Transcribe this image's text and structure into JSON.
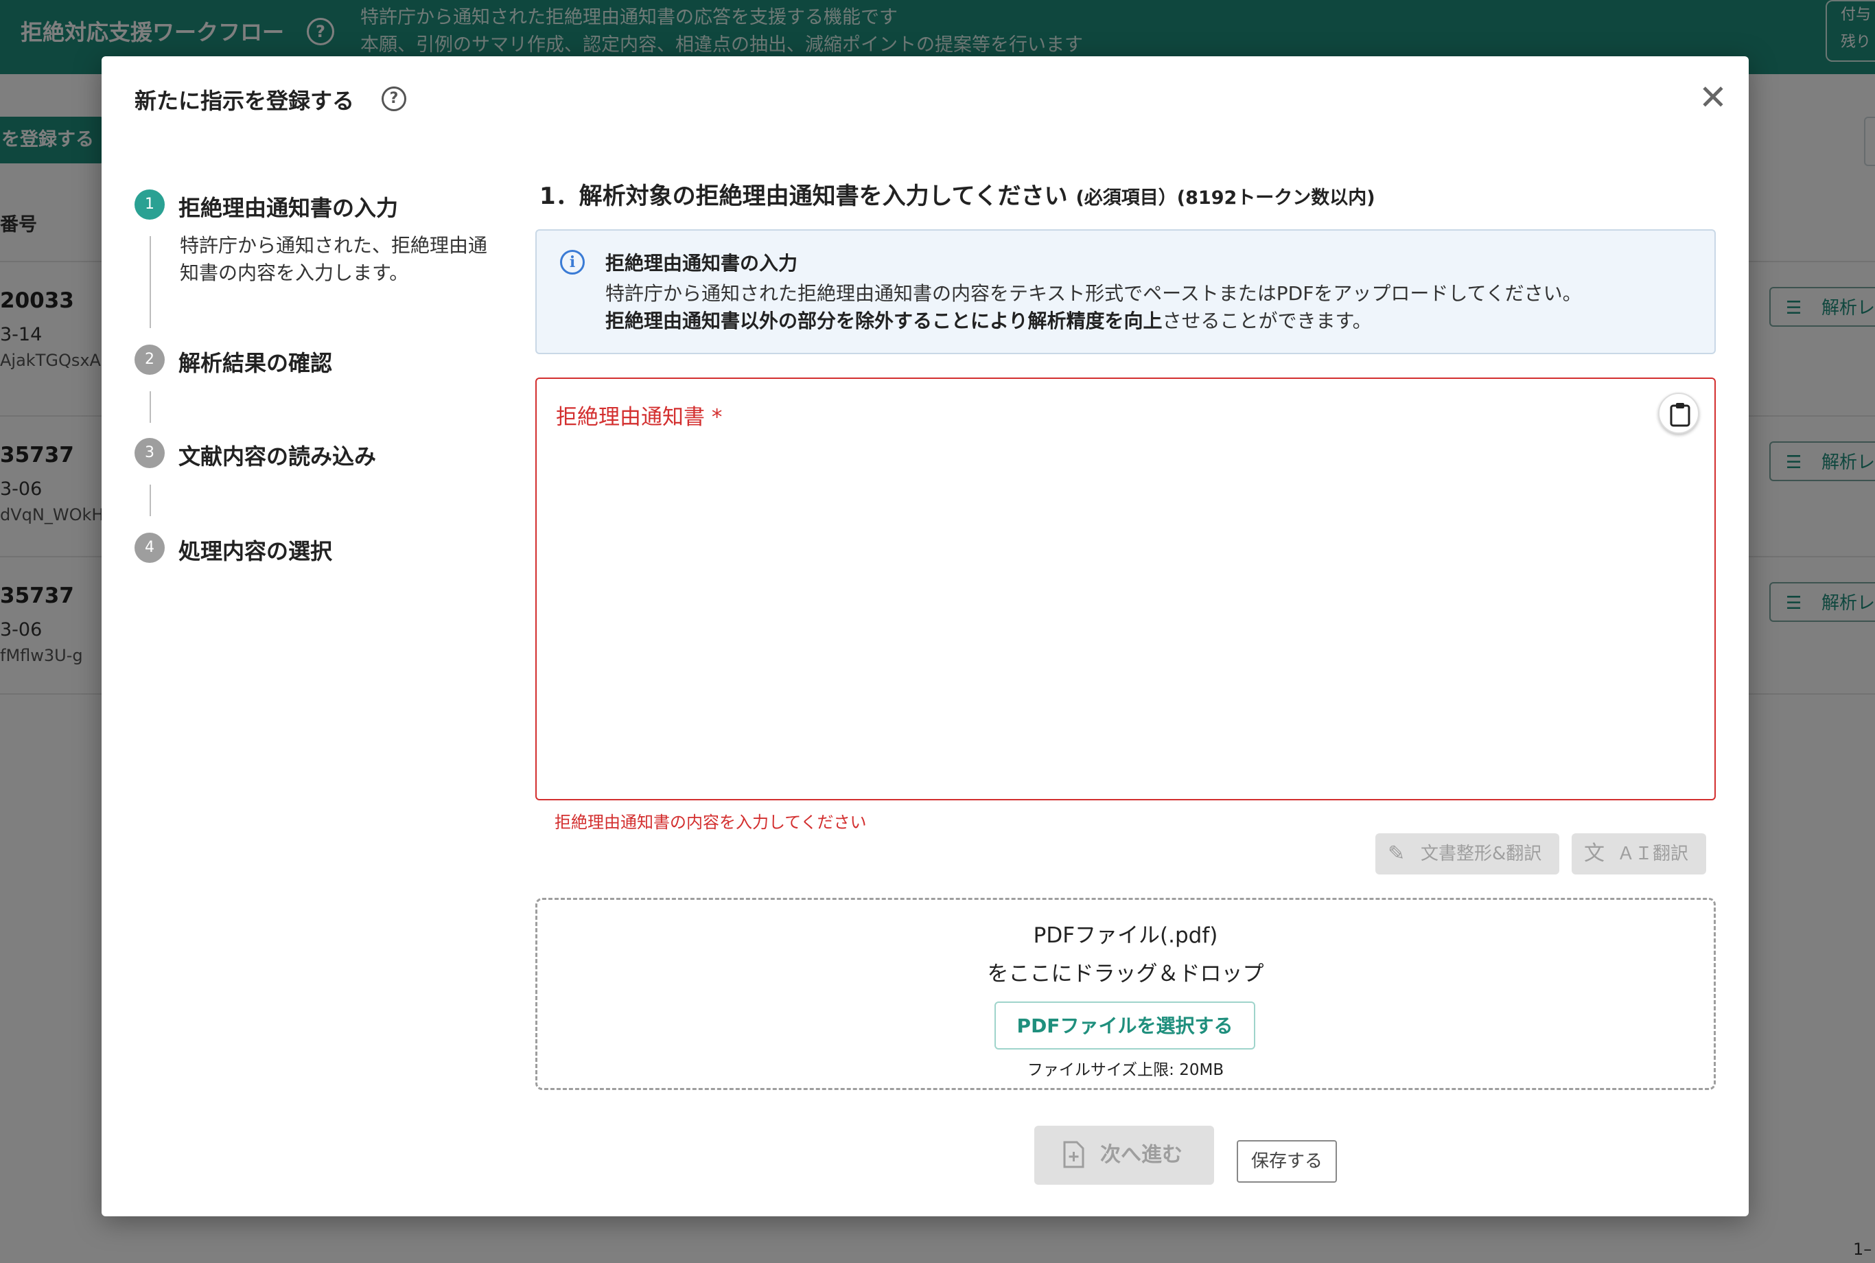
{
  "app": {
    "title": "拒絶対応支援ワークフロー",
    "description_line1": "特許庁から通知された拒絶理由通知書の応答を支援する機能です",
    "description_line2": "本願、引例のサマリ作成、認定内容、相違点の抽出、減縮ポイントの提案等を行います",
    "badge_line1": "付与",
    "badge_line2": "残り",
    "register_button": "を登録する",
    "column_header": "番号",
    "rows": [
      {
        "number": "20033",
        "date": "3-14",
        "sub": "AjakTGQsxA",
        "action": "解析レ"
      },
      {
        "number": "35737",
        "date": "3-06",
        "sub": "dVqN_WOkH",
        "action": "解析レ"
      },
      {
        "number": "35737",
        "date": "3-06",
        "sub": "fMflw3U-g",
        "action": "解析レ"
      }
    ],
    "pager": "1–"
  },
  "modal": {
    "title": "新たに指示を登録する",
    "steps": [
      {
        "number": "1",
        "label": "拒絶理由通知書の入力",
        "description": "特許庁から通知された、拒絶理由通知書の内容を入力します。"
      },
      {
        "number": "2",
        "label": "解析結果の確認"
      },
      {
        "number": "3",
        "label": "文献内容の読み込み"
      },
      {
        "number": "4",
        "label": "処理内容の選択"
      }
    ],
    "section_heading": "1．解析対象の拒絶理由通知書を入力してください",
    "section_heading_note": "(必須項目）(8192トークン数以内)",
    "info": {
      "title": "拒絶理由通知書の入力",
      "line1": "特許庁から通知された拒絶理由通知書の内容をテキスト形式でペーストまたはPDFをアップロードしてください。",
      "line2_bold": "拒絶理由通知書以外の部分を除外することにより解析精度を向上",
      "line2_rest": "させることができます。"
    },
    "textarea": {
      "label": "拒絶理由通知書 *",
      "value": "",
      "error": "拒絶理由通知書の内容を入力してください"
    },
    "format_translate_button": "文書整形&翻訳",
    "ai_translate_button": "ＡＩ翻訳",
    "dropzone": {
      "line1": "PDFファイル(.pdf)",
      "line2": "をここにドラッグ＆ドロップ",
      "select_button": "PDFファイルを選択する",
      "limit": "ファイルサイズ上限: 20MB"
    },
    "next_button": "次へ進む",
    "save_button": "保存する"
  },
  "colors": {
    "brand": "#1f8f7d",
    "active_step": "#2aa193",
    "error": "#d32f2f",
    "info_bg": "#eff5fb"
  },
  "icons": [
    "help-icon",
    "close-icon",
    "info-icon",
    "clipboard-icon",
    "pen-icon",
    "translate-icon",
    "add-document-icon",
    "analyze-icon"
  ]
}
